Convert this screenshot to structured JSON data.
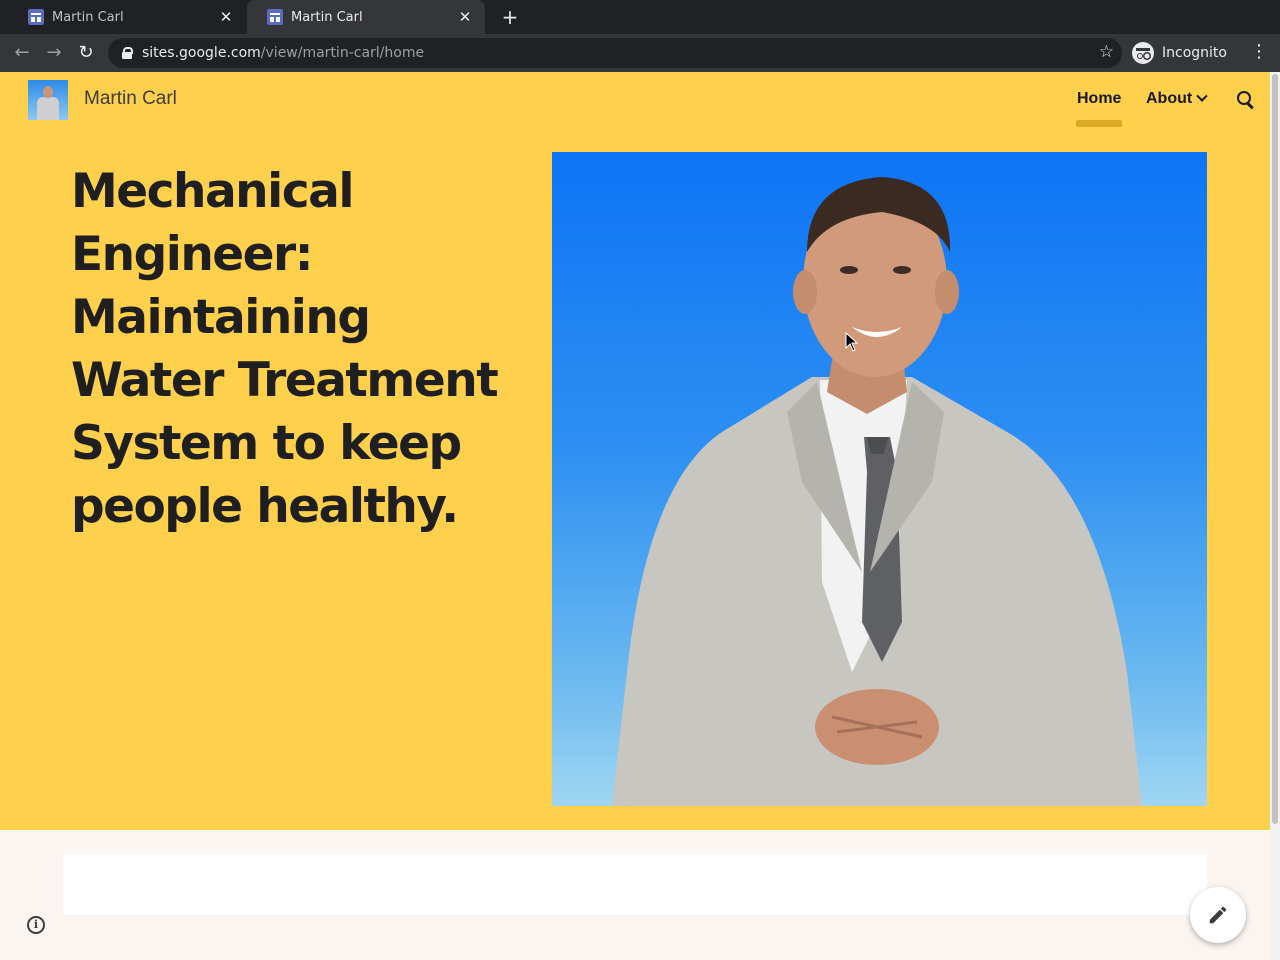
{
  "browser": {
    "tabs": [
      {
        "title": "Martin Carl",
        "active": false
      },
      {
        "title": "Martin Carl",
        "active": true
      }
    ],
    "new_tab_icon": "plus-icon",
    "url_host": "sites.google.com",
    "url_path": "/view/martin-carl/home",
    "profile_label": "Incognito"
  },
  "site": {
    "title": "Martin Carl",
    "nav": {
      "home": "Home",
      "about": "About"
    },
    "headline": "Mechanical Engineer: Maintaining Water Treatment System to keep people healthy.",
    "hero_image": "man in grey suit with blue background",
    "colors": {
      "hero_background": "#ffd04b",
      "nav_underline": "#d9a921",
      "page_background": "#fbf5f1"
    }
  }
}
